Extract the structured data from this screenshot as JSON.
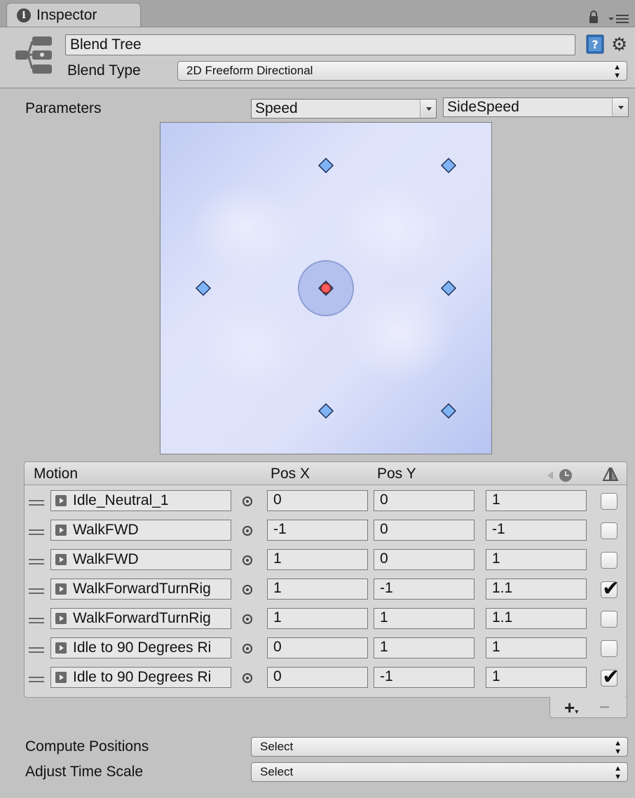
{
  "tab": {
    "title": "Inspector"
  },
  "header": {
    "name": "Blend Tree",
    "blend_type_label": "Blend Type",
    "blend_type_value": "2D Freeform Directional"
  },
  "parameters": {
    "label": "Parameters",
    "x_param": "Speed",
    "y_param": "SideSpeed"
  },
  "graph": {
    "current_point": [
      0,
      0
    ],
    "motion_points": [
      [
        0,
        0
      ],
      [
        -1,
        0
      ],
      [
        1,
        0
      ],
      [
        1,
        -1
      ],
      [
        1,
        1
      ],
      [
        0,
        1
      ],
      [
        0,
        -1
      ]
    ],
    "range": [
      -1,
      1
    ]
  },
  "motion": {
    "headers": {
      "motion": "Motion",
      "pos_x": "Pos X",
      "pos_y": "Pos Y"
    },
    "rows": [
      {
        "clip": "Idle_Neutral_1",
        "pos_x": "0",
        "pos_y": "0",
        "speed": "1",
        "mirror": false
      },
      {
        "clip": "WalkFWD",
        "pos_x": "-1",
        "pos_y": "0",
        "speed": "-1",
        "mirror": false
      },
      {
        "clip": "WalkFWD",
        "pos_x": "1",
        "pos_y": "0",
        "speed": "1",
        "mirror": false
      },
      {
        "clip": "WalkForwardTurnRig",
        "pos_x": "1",
        "pos_y": "-1",
        "speed": "1.1",
        "mirror": true
      },
      {
        "clip": "WalkForwardTurnRig",
        "pos_x": "1",
        "pos_y": "1",
        "speed": "1.1",
        "mirror": false
      },
      {
        "clip": "Idle to 90 Degrees Ri",
        "pos_x": "0",
        "pos_y": "1",
        "speed": "1",
        "mirror": false
      },
      {
        "clip": "Idle to 90 Degrees Ri",
        "pos_x": "0",
        "pos_y": "-1",
        "speed": "1",
        "mirror": true
      }
    ]
  },
  "options": {
    "compute_label": "Compute Positions",
    "compute_value": "Select",
    "adjust_label": "Adjust Time Scale",
    "adjust_value": "Select"
  },
  "colors": {
    "point_fill": "#7fb3f5",
    "current_point": "#ff5a5a",
    "influence": "#a9b8ec"
  }
}
